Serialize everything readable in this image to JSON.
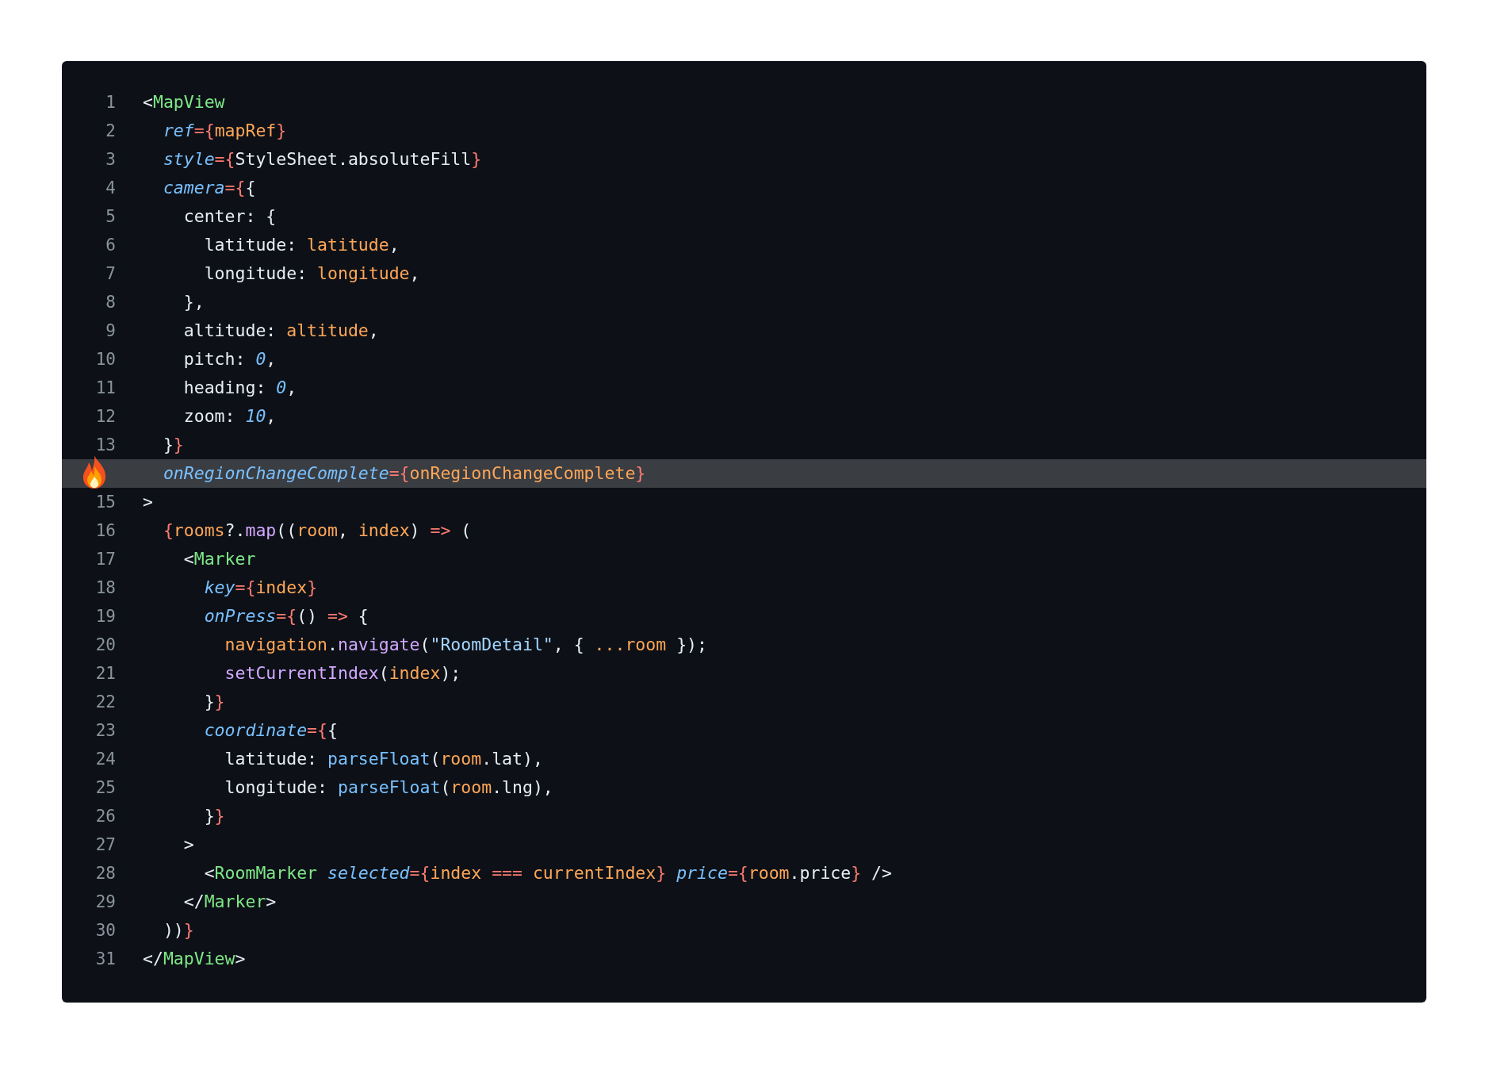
{
  "editor": {
    "lines": [
      {
        "kind": "number",
        "number": "1",
        "highlighted": false,
        "tokens": [
          {
            "kind": "plain",
            "text": "<"
          },
          {
            "kind": "tag",
            "text": "MapView"
          }
        ]
      },
      {
        "kind": "number",
        "number": "2",
        "highlighted": false,
        "tokens": [
          {
            "kind": "attr",
            "text": "  ref"
          },
          {
            "kind": "brace",
            "text": "={"
          },
          {
            "kind": "var",
            "text": "mapRef"
          },
          {
            "kind": "brace",
            "text": "}"
          }
        ]
      },
      {
        "kind": "number",
        "number": "3",
        "highlighted": false,
        "tokens": [
          {
            "kind": "attr",
            "text": "  style"
          },
          {
            "kind": "brace",
            "text": "={"
          },
          {
            "kind": "plain",
            "text": "StyleSheet.absoluteFill"
          },
          {
            "kind": "brace",
            "text": "}"
          }
        ]
      },
      {
        "kind": "number",
        "number": "4",
        "highlighted": false,
        "tokens": [
          {
            "kind": "attr",
            "text": "  camera"
          },
          {
            "kind": "brace",
            "text": "={"
          },
          {
            "kind": "plain",
            "text": "{"
          }
        ]
      },
      {
        "kind": "number",
        "number": "5",
        "highlighted": false,
        "tokens": [
          {
            "kind": "plain",
            "text": "    center: {"
          }
        ]
      },
      {
        "kind": "number",
        "number": "6",
        "highlighted": false,
        "tokens": [
          {
            "kind": "plain",
            "text": "      latitude: "
          },
          {
            "kind": "var",
            "text": "latitude"
          },
          {
            "kind": "plain",
            "text": ","
          }
        ]
      },
      {
        "kind": "number",
        "number": "7",
        "highlighted": false,
        "tokens": [
          {
            "kind": "plain",
            "text": "      longitude: "
          },
          {
            "kind": "var",
            "text": "longitude"
          },
          {
            "kind": "plain",
            "text": ","
          }
        ]
      },
      {
        "kind": "number",
        "number": "8",
        "highlighted": false,
        "tokens": [
          {
            "kind": "plain",
            "text": "    },"
          }
        ]
      },
      {
        "kind": "number",
        "number": "9",
        "highlighted": false,
        "tokens": [
          {
            "kind": "plain",
            "text": "    altitude: "
          },
          {
            "kind": "var",
            "text": "altitude"
          },
          {
            "kind": "plain",
            "text": ","
          }
        ]
      },
      {
        "kind": "number",
        "number": "10",
        "highlighted": false,
        "tokens": [
          {
            "kind": "plain",
            "text": "    pitch: "
          },
          {
            "kind": "number",
            "text": "0"
          },
          {
            "kind": "plain",
            "text": ","
          }
        ]
      },
      {
        "kind": "number",
        "number": "11",
        "highlighted": false,
        "tokens": [
          {
            "kind": "plain",
            "text": "    heading: "
          },
          {
            "kind": "number",
            "text": "0"
          },
          {
            "kind": "plain",
            "text": ","
          }
        ]
      },
      {
        "kind": "number",
        "number": "12",
        "highlighted": false,
        "tokens": [
          {
            "kind": "plain",
            "text": "    zoom: "
          },
          {
            "kind": "number",
            "text": "10"
          },
          {
            "kind": "plain",
            "text": ","
          }
        ]
      },
      {
        "kind": "number",
        "number": "13",
        "highlighted": false,
        "tokens": [
          {
            "kind": "plain",
            "text": "  }"
          },
          {
            "kind": "brace",
            "text": "}"
          }
        ]
      },
      {
        "kind": "flame",
        "highlighted": true,
        "tokens": [
          {
            "kind": "attr",
            "text": "  onRegionChangeComplete"
          },
          {
            "kind": "brace",
            "text": "={"
          },
          {
            "kind": "var",
            "text": "onRegionChangeComplete"
          },
          {
            "kind": "brace",
            "text": "}"
          }
        ]
      },
      {
        "kind": "number",
        "number": "15",
        "highlighted": false,
        "tokens": [
          {
            "kind": "plain",
            "text": ">"
          }
        ]
      },
      {
        "kind": "number",
        "number": "16",
        "highlighted": false,
        "tokens": [
          {
            "kind": "brace",
            "text": "  {"
          },
          {
            "kind": "var",
            "text": "rooms"
          },
          {
            "kind": "plain",
            "text": "?."
          },
          {
            "kind": "func",
            "text": "map"
          },
          {
            "kind": "plain",
            "text": "(("
          },
          {
            "kind": "var",
            "text": "room"
          },
          {
            "kind": "plain",
            "text": ", "
          },
          {
            "kind": "var",
            "text": "index"
          },
          {
            "kind": "plain",
            "text": ") "
          },
          {
            "kind": "op",
            "text": "=>"
          },
          {
            "kind": "plain",
            "text": " ("
          }
        ]
      },
      {
        "kind": "number",
        "number": "17",
        "highlighted": false,
        "tokens": [
          {
            "kind": "plain",
            "text": "    <"
          },
          {
            "kind": "tag",
            "text": "Marker"
          }
        ]
      },
      {
        "kind": "number",
        "number": "18",
        "highlighted": false,
        "tokens": [
          {
            "kind": "attr",
            "text": "      key"
          },
          {
            "kind": "brace",
            "text": "={"
          },
          {
            "kind": "var",
            "text": "index"
          },
          {
            "kind": "brace",
            "text": "}"
          }
        ]
      },
      {
        "kind": "number",
        "number": "19",
        "highlighted": false,
        "tokens": [
          {
            "kind": "attr",
            "text": "      onPress"
          },
          {
            "kind": "brace",
            "text": "={"
          },
          {
            "kind": "plain",
            "text": "() "
          },
          {
            "kind": "op",
            "text": "=>"
          },
          {
            "kind": "plain",
            "text": " {"
          }
        ]
      },
      {
        "kind": "number",
        "number": "20",
        "highlighted": false,
        "tokens": [
          {
            "kind": "var",
            "text": "        navigation"
          },
          {
            "kind": "plain",
            "text": "."
          },
          {
            "kind": "func",
            "text": "navigate"
          },
          {
            "kind": "plain",
            "text": "("
          },
          {
            "kind": "string",
            "text": "\"RoomDetail\""
          },
          {
            "kind": "plain",
            "text": ", { "
          },
          {
            "kind": "var",
            "text": "...room"
          },
          {
            "kind": "plain",
            "text": " });"
          }
        ]
      },
      {
        "kind": "number",
        "number": "21",
        "highlighted": false,
        "tokens": [
          {
            "kind": "func",
            "text": "        setCurrentIndex"
          },
          {
            "kind": "plain",
            "text": "("
          },
          {
            "kind": "var",
            "text": "index"
          },
          {
            "kind": "plain",
            "text": ");"
          }
        ]
      },
      {
        "kind": "number",
        "number": "22",
        "highlighted": false,
        "tokens": [
          {
            "kind": "plain",
            "text": "      }"
          },
          {
            "kind": "brace",
            "text": "}"
          }
        ]
      },
      {
        "kind": "number",
        "number": "23",
        "highlighted": false,
        "tokens": [
          {
            "kind": "attr",
            "text": "      coordinate"
          },
          {
            "kind": "brace",
            "text": "={"
          },
          {
            "kind": "plain",
            "text": "{"
          }
        ]
      },
      {
        "kind": "number",
        "number": "24",
        "highlighted": false,
        "tokens": [
          {
            "kind": "plain",
            "text": "        latitude: "
          },
          {
            "kind": "method",
            "text": "parseFloat"
          },
          {
            "kind": "plain",
            "text": "("
          },
          {
            "kind": "var",
            "text": "room"
          },
          {
            "kind": "plain",
            "text": ".lat),"
          }
        ]
      },
      {
        "kind": "number",
        "number": "25",
        "highlighted": false,
        "tokens": [
          {
            "kind": "plain",
            "text": "        longitude: "
          },
          {
            "kind": "method",
            "text": "parseFloat"
          },
          {
            "kind": "plain",
            "text": "("
          },
          {
            "kind": "var",
            "text": "room"
          },
          {
            "kind": "plain",
            "text": ".lng),"
          }
        ]
      },
      {
        "kind": "number",
        "number": "26",
        "highlighted": false,
        "tokens": [
          {
            "kind": "plain",
            "text": "      }"
          },
          {
            "kind": "brace",
            "text": "}"
          }
        ]
      },
      {
        "kind": "number",
        "number": "27",
        "highlighted": false,
        "tokens": [
          {
            "kind": "plain",
            "text": "    >"
          }
        ]
      },
      {
        "kind": "number",
        "number": "28",
        "highlighted": false,
        "tokens": [
          {
            "kind": "plain",
            "text": "      <"
          },
          {
            "kind": "tag",
            "text": "RoomMarker"
          },
          {
            "kind": "attr",
            "text": " selected"
          },
          {
            "kind": "brace",
            "text": "={"
          },
          {
            "kind": "var",
            "text": "index "
          },
          {
            "kind": "op",
            "text": "==="
          },
          {
            "kind": "var",
            "text": " currentIndex"
          },
          {
            "kind": "brace",
            "text": "}"
          },
          {
            "kind": "attr",
            "text": " price"
          },
          {
            "kind": "brace",
            "text": "={"
          },
          {
            "kind": "var",
            "text": "room"
          },
          {
            "kind": "plain",
            "text": ".price"
          },
          {
            "kind": "brace",
            "text": "}"
          },
          {
            "kind": "plain",
            "text": " />"
          }
        ]
      },
      {
        "kind": "number",
        "number": "29",
        "highlighted": false,
        "tokens": [
          {
            "kind": "plain",
            "text": "    </"
          },
          {
            "kind": "tag",
            "text": "Marker"
          },
          {
            "kind": "plain",
            "text": ">"
          }
        ]
      },
      {
        "kind": "number",
        "number": "30",
        "highlighted": false,
        "tokens": [
          {
            "kind": "plain",
            "text": "  ))"
          },
          {
            "kind": "brace",
            "text": "}"
          }
        ]
      },
      {
        "kind": "number",
        "number": "31",
        "highlighted": false,
        "tokens": [
          {
            "kind": "plain",
            "text": "</"
          },
          {
            "kind": "tag",
            "text": "MapView"
          },
          {
            "kind": "plain",
            "text": ">"
          }
        ]
      }
    ]
  }
}
